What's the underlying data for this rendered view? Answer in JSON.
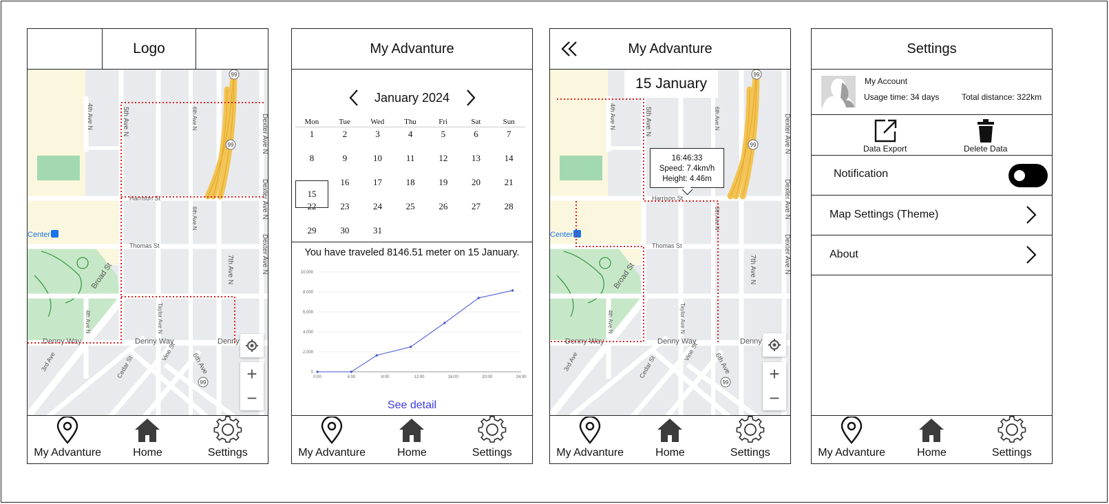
{
  "nav": [
    {
      "label": "My Advanture",
      "icon": "map-pin-icon"
    },
    {
      "label": "Home",
      "icon": "home-icon"
    },
    {
      "label": "Settings",
      "icon": "gear-icon"
    }
  ],
  "screen1": {
    "logo": "Logo"
  },
  "screen2": {
    "title": "My Advanture",
    "month": "January 2024",
    "weekdays": [
      "Mon",
      "Tue",
      "Wed",
      "Thu",
      "Fri",
      "Sat",
      "Sun"
    ],
    "days": [
      "1",
      "2",
      "3",
      "4",
      "5",
      "6",
      "7",
      "8",
      "9",
      "10",
      "11",
      "12",
      "13",
      "14",
      "15",
      "16",
      "17",
      "18",
      "19",
      "20",
      "21",
      "22",
      "23",
      "24",
      "25",
      "26",
      "27",
      "28",
      "29",
      "30",
      "31"
    ],
    "selected_day": "15",
    "summary": "You have traveled 8146.51 meter on 15 January.",
    "see_detail": "See detail"
  },
  "screen3": {
    "title": "My Advanture",
    "date": "15 January",
    "tooltip": {
      "time": "16:46:33",
      "speed": "Speed: 7.4km/h",
      "height": "Height: 4.46m"
    }
  },
  "screen4": {
    "title": "Settings",
    "account": {
      "name": "My Account",
      "usage": "Usage time: 34 days",
      "distance": "Total distance: 322km"
    },
    "actions": [
      {
        "label": "Data Export",
        "icon": "export-icon"
      },
      {
        "label": "Delete Data",
        "icon": "trash-icon"
      }
    ],
    "notification": "Notification",
    "map_settings": "Map Settings (Theme)",
    "about": "About"
  },
  "map_labels": {
    "harrison": "Harrison St",
    "thomas": "Thomas St",
    "denny": "Denny Way",
    "denny_short": "Denny",
    "broad": "Broad St",
    "center": "Center",
    "ave4": "4th Ave N",
    "ave5": "5th Ave N",
    "ave6": "6th Ave N",
    "ave7": "7th Ave N",
    "dexter": "Dexter Ave N",
    "taylor": "Taylor Ave N",
    "cedar": "Cedar St",
    "vine": "Vine St",
    "third": "3rd Ave",
    "sixth": "6th Ave",
    "hwy": "99"
  },
  "chart_data": {
    "type": "line",
    "title": "",
    "x": [
      "0:00",
      "4:00",
      "8:00",
      "12:00",
      "16:00",
      "20:00",
      "24:00"
    ],
    "points": [
      [
        0,
        0
      ],
      [
        4,
        0
      ],
      [
        7,
        1650
      ],
      [
        11,
        2500
      ],
      [
        15,
        4900
      ],
      [
        19,
        7400
      ],
      [
        23,
        8146.51
      ]
    ],
    "y_ticks": [
      "0",
      "2,000",
      "4,000",
      "6,000",
      "8,000",
      "10,000"
    ],
    "ylim": [
      0,
      10000
    ],
    "xlim": [
      0,
      24
    ],
    "color": "#3f51d6"
  }
}
